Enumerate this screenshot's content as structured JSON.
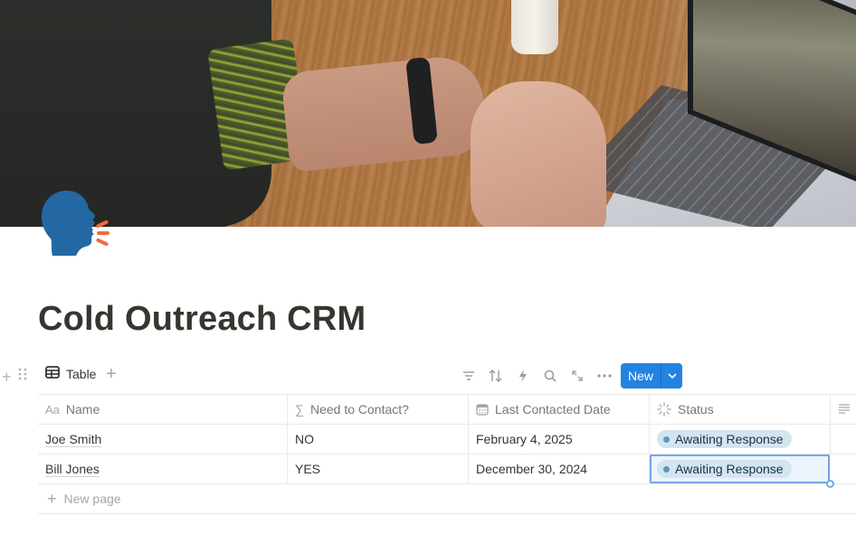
{
  "page": {
    "title": "Cold Outreach CRM",
    "icon": "speaking-head-icon",
    "cover": "cover-image-video-call"
  },
  "view": {
    "tab_label": "Table",
    "tab_icon": "table-icon",
    "add_view_icon": "plus-icon"
  },
  "toolbar": {
    "icons": [
      "filter-icon",
      "sort-icon",
      "automation-bolt-icon",
      "search-icon",
      "expand-icon",
      "more-icon"
    ],
    "new_label": "New",
    "new_dropdown_icon": "chevron-down-icon",
    "accent": "#2383e2"
  },
  "table": {
    "columns": [
      {
        "label": "Name",
        "icon": "title-aa-icon"
      },
      {
        "label": "Need to Contact?",
        "icon": "formula-sigma-icon"
      },
      {
        "label": "Last Contacted Date",
        "icon": "calendar-icon"
      },
      {
        "label": "Status",
        "icon": "status-spinner-icon"
      }
    ],
    "rows": [
      {
        "name": "Joe Smith",
        "need_to_contact": "NO",
        "last_contacted": "February 4, 2025",
        "status": "Awaiting Response"
      },
      {
        "name": "Bill Jones",
        "need_to_contact": "YES",
        "last_contacted": "December 30, 2024",
        "status": "Awaiting Response"
      }
    ],
    "status_colors": {
      "Awaiting Response": {
        "bg": "#d3e5ef",
        "dot": "#5b97bd",
        "text": "#183347"
      }
    },
    "new_page_label": "New page",
    "selected_cell": {
      "row": 2,
      "column": "Status"
    }
  }
}
